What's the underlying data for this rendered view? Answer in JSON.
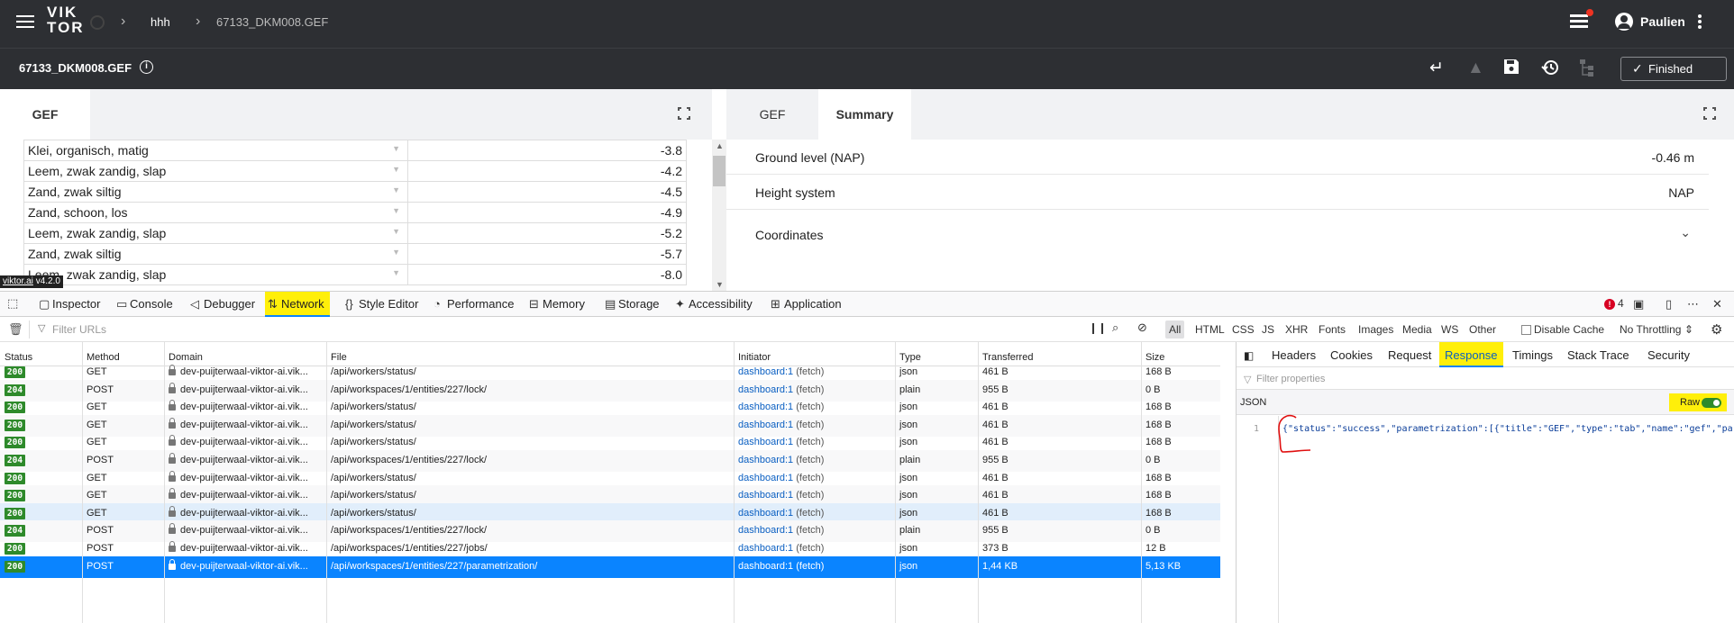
{
  "topbar": {
    "logo_line1": "VIK",
    "logo_line2": "TOR",
    "breadcrumb_project": "hhh",
    "breadcrumb_entity": "67133_DKM008.GEF",
    "user_name": "Paulien"
  },
  "entitybar": {
    "title": "67133_DKM008.GEF",
    "finished_label": "Finished"
  },
  "left_panel": {
    "tab": "GEF",
    "rows": [
      {
        "name": "Klei, organisch, matig",
        "value": "-3.8"
      },
      {
        "name": "Leem, zwak zandig, slap",
        "value": "-4.2"
      },
      {
        "name": "Zand, zwak siltig",
        "value": "-4.5"
      },
      {
        "name": "Zand, schoon, los",
        "value": "-4.9"
      },
      {
        "name": "Leem, zwak zandig, slap",
        "value": "-5.2"
      },
      {
        "name": "Zand, zwak siltig",
        "value": "-5.7"
      },
      {
        "name": "Leem, zwak zandig, slap",
        "value": "-8.0"
      }
    ]
  },
  "right_panel": {
    "tabs": [
      "GEF",
      "Summary"
    ],
    "rows": [
      {
        "label": "Ground level (NAP)",
        "value": "-0.46 m"
      },
      {
        "label": "Height system",
        "value": "NAP"
      },
      {
        "label": "Coordinates",
        "value": ""
      }
    ]
  },
  "version_badge": {
    "site": "viktor.ai",
    "version": "v4.2.0"
  },
  "devtools": {
    "tabs": [
      "Inspector",
      "Console",
      "Debugger",
      "Network",
      "Style Editor",
      "Performance",
      "Memory",
      "Storage",
      "Accessibility",
      "Application"
    ],
    "error_count": "4",
    "filter_placeholder": "Filter URLs",
    "type_filters": [
      "All",
      "HTML",
      "CSS",
      "JS",
      "XHR",
      "Fonts",
      "Images",
      "Media",
      "WS",
      "Other"
    ],
    "disable_cache_label": "Disable Cache",
    "throttling_label": "No Throttling"
  },
  "network": {
    "columns": [
      "Status",
      "Method",
      "Domain",
      "File",
      "Initiator",
      "Type",
      "Transferred",
      "Size"
    ],
    "rows": [
      {
        "status": "200",
        "method": "GET",
        "domain": "dev-puijterwaal-viktor-ai.vik...",
        "file": "/api/workers/status/",
        "initiator": "dashboard:1",
        "initiator_kind": "(fetch)",
        "type": "json",
        "transferred": "461 B",
        "size": "168 B"
      },
      {
        "status": "204",
        "method": "POST",
        "domain": "dev-puijterwaal-viktor-ai.vik...",
        "file": "/api/workspaces/1/entities/227/lock/",
        "initiator": "dashboard:1",
        "initiator_kind": "(fetch)",
        "type": "plain",
        "transferred": "955 B",
        "size": "0 B"
      },
      {
        "status": "200",
        "method": "GET",
        "domain": "dev-puijterwaal-viktor-ai.vik...",
        "file": "/api/workers/status/",
        "initiator": "dashboard:1",
        "initiator_kind": "(fetch)",
        "type": "json",
        "transferred": "461 B",
        "size": "168 B"
      },
      {
        "status": "200",
        "method": "GET",
        "domain": "dev-puijterwaal-viktor-ai.vik...",
        "file": "/api/workers/status/",
        "initiator": "dashboard:1",
        "initiator_kind": "(fetch)",
        "type": "json",
        "transferred": "461 B",
        "size": "168 B"
      },
      {
        "status": "200",
        "method": "GET",
        "domain": "dev-puijterwaal-viktor-ai.vik...",
        "file": "/api/workers/status/",
        "initiator": "dashboard:1",
        "initiator_kind": "(fetch)",
        "type": "json",
        "transferred": "461 B",
        "size": "168 B"
      },
      {
        "status": "204",
        "method": "POST",
        "domain": "dev-puijterwaal-viktor-ai.vik...",
        "file": "/api/workspaces/1/entities/227/lock/",
        "initiator": "dashboard:1",
        "initiator_kind": "(fetch)",
        "type": "plain",
        "transferred": "955 B",
        "size": "0 B"
      },
      {
        "status": "200",
        "method": "GET",
        "domain": "dev-puijterwaal-viktor-ai.vik...",
        "file": "/api/workers/status/",
        "initiator": "dashboard:1",
        "initiator_kind": "(fetch)",
        "type": "json",
        "transferred": "461 B",
        "size": "168 B"
      },
      {
        "status": "200",
        "method": "GET",
        "domain": "dev-puijterwaal-viktor-ai.vik...",
        "file": "/api/workers/status/",
        "initiator": "dashboard:1",
        "initiator_kind": "(fetch)",
        "type": "json",
        "transferred": "461 B",
        "size": "168 B"
      },
      {
        "status": "200",
        "method": "GET",
        "domain": "dev-puijterwaal-viktor-ai.vik...",
        "file": "/api/workers/status/",
        "initiator": "dashboard:1",
        "initiator_kind": "(fetch)",
        "type": "json",
        "transferred": "461 B",
        "size": "168 B"
      },
      {
        "status": "204",
        "method": "POST",
        "domain": "dev-puijterwaal-viktor-ai.vik...",
        "file": "/api/workspaces/1/entities/227/lock/",
        "initiator": "dashboard:1",
        "initiator_kind": "(fetch)",
        "type": "plain",
        "transferred": "955 B",
        "size": "0 B"
      },
      {
        "status": "200",
        "method": "POST",
        "domain": "dev-puijterwaal-viktor-ai.vik...",
        "file": "/api/workspaces/1/entities/227/jobs/",
        "initiator": "dashboard:1",
        "initiator_kind": "(fetch)",
        "type": "json",
        "transferred": "373 B",
        "size": "12 B"
      },
      {
        "status": "200",
        "method": "POST",
        "domain": "dev-puijterwaal-viktor-ai.vik...",
        "file": "/api/workspaces/1/entities/227/parametrization/",
        "initiator": "dashboard:1",
        "initiator_kind": "(fetch)",
        "type": "json",
        "transferred": "1,44 KB",
        "size": "5,13 KB"
      }
    ]
  },
  "details": {
    "tabs": [
      "Headers",
      "Cookies",
      "Request",
      "Response",
      "Timings",
      "Stack Trace",
      "Security"
    ],
    "filter_placeholder": "Filter properties",
    "json_label": "JSON",
    "raw_label": "Raw",
    "line_number": "1",
    "response_text": "{\"status\":\"success\",\"parametrization\":[{\"title\":\"GEF\",\"type\":\"tab\",\"name\":\"gef\",\"par"
  },
  "colors": {
    "header_bg": "#2d2f33",
    "highlight": "#ffef0a",
    "selection": "#0a84ff",
    "status_ok": "#2e8a2b"
  }
}
